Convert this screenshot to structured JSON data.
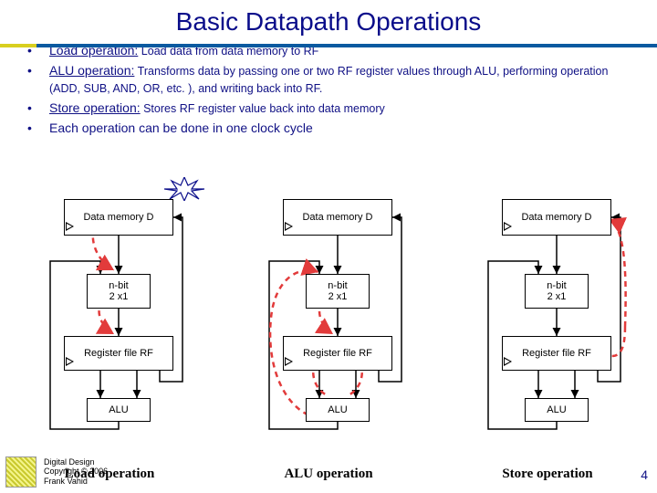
{
  "title": "Basic Datapath Operations",
  "bullets": [
    {
      "lead": "Load operation:",
      "rest": " Load data from data memory to RF"
    },
    {
      "lead": "ALU operation:",
      "rest": " Transforms data by passing one or two RF register values through ALU, performing operation (ADD, SUB, AND, OR, etc. ), and writing back into RF."
    },
    {
      "lead": "Store operation:",
      "rest": " Stores RF register value back into data memory"
    },
    {
      "lead": "Each operation can be done in one clock cycle",
      "rest": ""
    }
  ],
  "block_labels": {
    "dmem": "Data memory D",
    "mux_line1": "n-bit",
    "mux_line2": "2 x1",
    "rf": "Register file RF",
    "alu": "ALU"
  },
  "captions": [
    "Load operation",
    "ALU operation",
    "Store operation"
  ],
  "footer": {
    "line1": "Digital Design",
    "line2": "Copyright © 2006",
    "line3": "Frank Vahid"
  },
  "page_number": "4",
  "colors": {
    "title": "#0a0d8a",
    "bullet_text": "#101185",
    "dash": "#e23b3b"
  }
}
